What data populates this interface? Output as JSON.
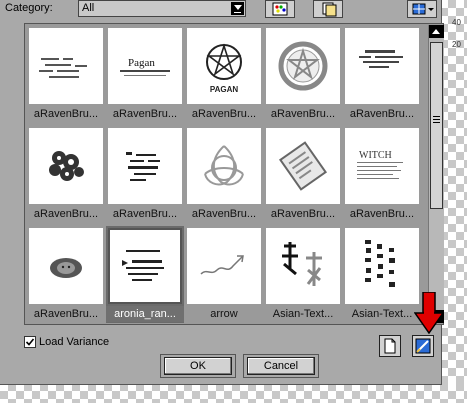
{
  "category": {
    "label": "Category:",
    "value": "All"
  },
  "toolbar": {
    "icons": [
      "palette-icon",
      "folder-copy-icon",
      "view-options-icon"
    ]
  },
  "thumbnails": [
    {
      "label": "aRavenBru...",
      "icon": "scattered-text-brush"
    },
    {
      "label": "aRavenBru...",
      "icon": "pagan-wordmark-brush",
      "text": "Pagan"
    },
    {
      "label": "aRavenBru...",
      "icon": "pentacle-brush",
      "text": "PAGAN"
    },
    {
      "label": "aRavenBru...",
      "icon": "ornate-pentacle-brush"
    },
    {
      "label": "aRavenBru...",
      "icon": "script-text-brush"
    },
    {
      "label": "aRavenBru...",
      "icon": "floral-cluster-brush"
    },
    {
      "label": "aRavenBru...",
      "icon": "poem-text-brush"
    },
    {
      "label": "aRavenBru...",
      "icon": "triquetra-brush"
    },
    {
      "label": "aRavenBru...",
      "icon": "scroll-brush"
    },
    {
      "label": "aRavenBru...",
      "icon": "witch-text-brush",
      "text": "WITCH"
    },
    {
      "label": "aRavenBru...",
      "icon": "face-brush"
    },
    {
      "label": "aronia_ran...",
      "icon": "poets-text-brush",
      "selected": true
    },
    {
      "label": "arrow",
      "icon": "arrow-brush"
    },
    {
      "label": "Asian-Text...",
      "icon": "asian-calligraphy-brush"
    },
    {
      "label": "Asian-Text...",
      "icon": "asian-vertical-text-brush"
    }
  ],
  "load_variance": {
    "label": "Load Variance",
    "checked": true
  },
  "buttons": {
    "ok": "OK",
    "cancel": "Cancel"
  },
  "ruler": {
    "marks": [
      "40",
      "20"
    ]
  },
  "colors": {
    "selected": "#6b6b6b",
    "arrow": "#e00000"
  }
}
